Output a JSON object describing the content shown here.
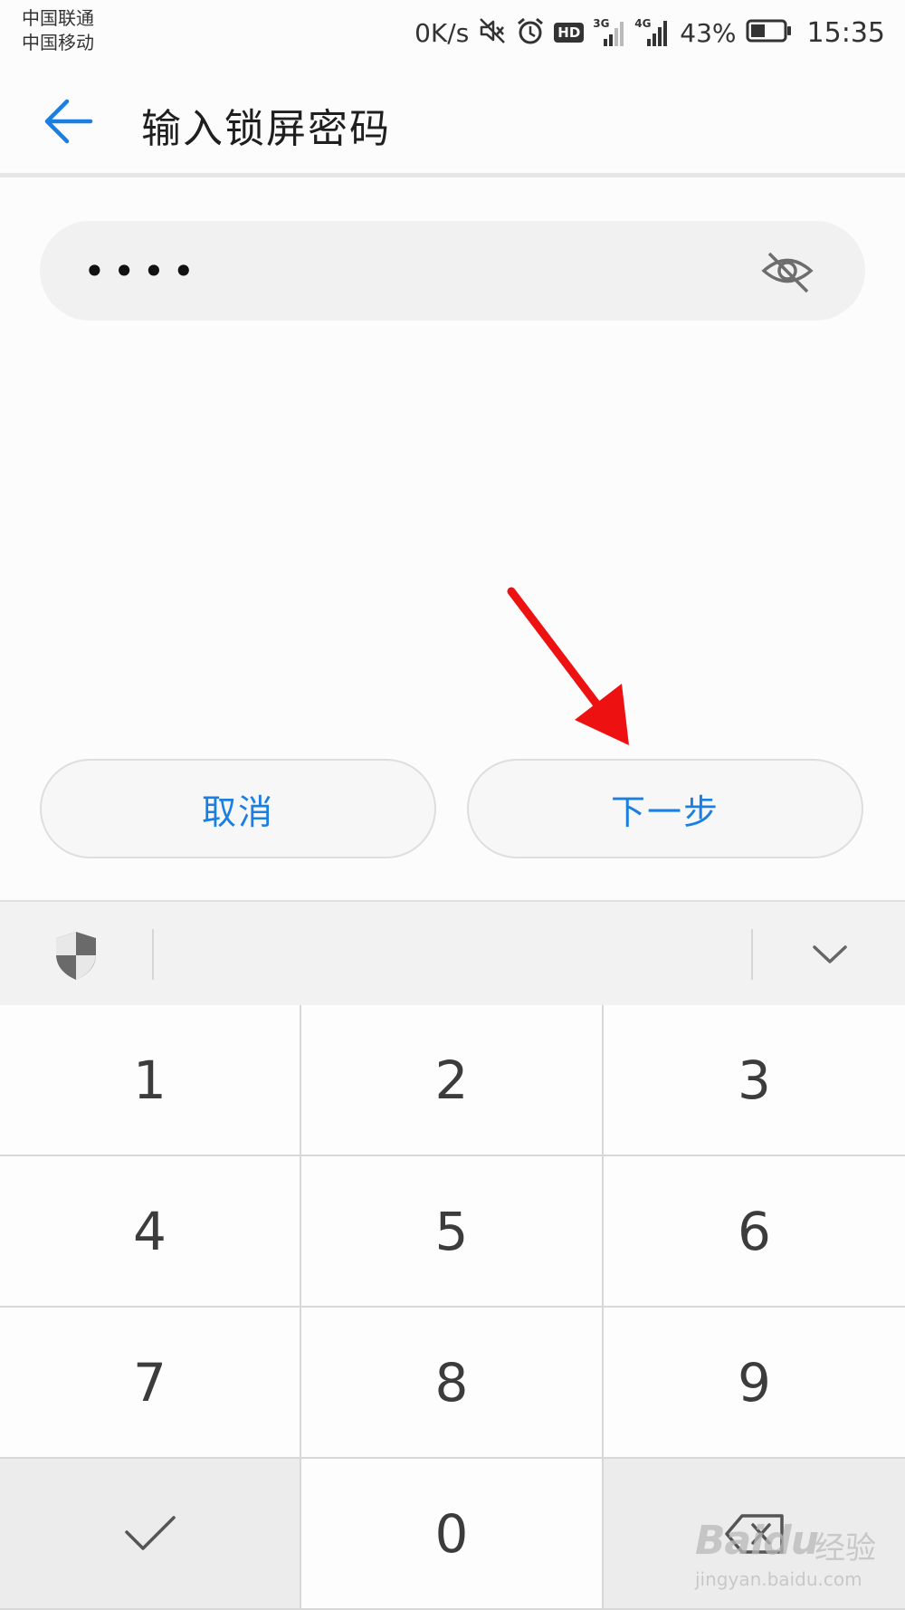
{
  "status_bar": {
    "carrier_1": "中国联通",
    "carrier_2": "中国移动",
    "net_speed": "0K/s",
    "hd": "HD",
    "signal_1_label": "3G",
    "signal_2_label": "4G",
    "battery_percent": "43%",
    "battery_level": 0.43,
    "time": "15:35",
    "icons": [
      "mute-icon",
      "alarm-icon",
      "hd-badge",
      "signal-3g-icon",
      "signal-4g-icon",
      "battery-icon"
    ]
  },
  "header": {
    "title": "输入锁屏密码",
    "back_icon": "arrow-left-icon"
  },
  "password": {
    "value": "••••",
    "visibility_icon": "eye-off-icon"
  },
  "actions": {
    "cancel": "取消",
    "next": "下一步"
  },
  "keyboard": {
    "toolbar_icons": [
      "shield-icon",
      "chevron-down-icon"
    ],
    "keys": [
      "1",
      "2",
      "3",
      "4",
      "5",
      "6",
      "7",
      "8",
      "9",
      "0"
    ],
    "confirm_icon": "checkmark-icon",
    "delete_icon": "backspace-icon"
  },
  "watermark": {
    "brand": "Baidu",
    "suffix": "经验",
    "url": "jingyan.baidu.com"
  },
  "colors": {
    "accent": "#1a7fe0",
    "annotation": "#ee1111",
    "background": "#fcfcfc",
    "field_bg": "#f1f1f1",
    "keypad_dark": "#ececec"
  }
}
